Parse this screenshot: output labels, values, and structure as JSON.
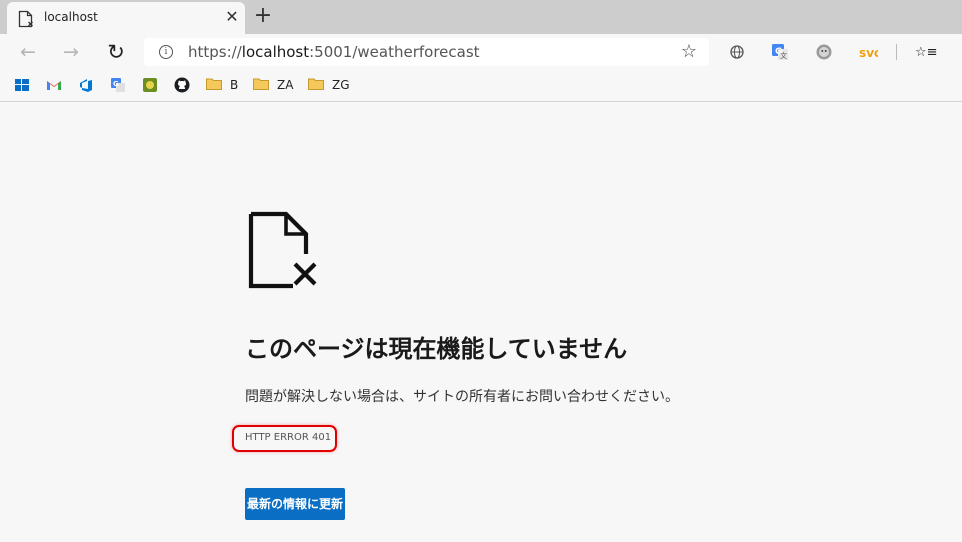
{
  "browser": {
    "tab": {
      "title": "localhost",
      "close_glyph": "✕",
      "favicon": "error-page-icon"
    },
    "new_tab_glyph": "+",
    "nav": {
      "back_glyph": "←",
      "forward_glyph": "→",
      "refresh_glyph": "↻"
    },
    "address": {
      "scheme": "https://",
      "host": "localhost",
      "rest": ":5001/weatherforecast",
      "info_glyph": "i",
      "favorite_glyph": "☆"
    },
    "extensions": [
      "globe-icon",
      "google-translate-icon",
      "cat-extension-icon",
      "svg-extension-icon"
    ],
    "favorites_glyph": "☆≡"
  },
  "bookmarks": [
    {
      "icon": "windows-icon",
      "label": ""
    },
    {
      "icon": "gmail-icon",
      "label": ""
    },
    {
      "icon": "azure-devops-icon",
      "label": ""
    },
    {
      "icon": "google-translate-icon",
      "label": ""
    },
    {
      "icon": "extension-icon",
      "label": ""
    },
    {
      "icon": "github-icon",
      "label": ""
    },
    {
      "icon": "folder-icon",
      "label": "B"
    },
    {
      "icon": "folder-icon",
      "label": "ZA"
    },
    {
      "icon": "folder-icon",
      "label": "ZG"
    }
  ],
  "page": {
    "heading": "このページは現在機能していません",
    "description": "問題が解決しない場合は、サイトの所有者にお問い合わせください。",
    "error_code": "HTTP ERROR 401",
    "reload_button": "最新の情報に更新"
  },
  "colors": {
    "accent": "#0a6fc4",
    "highlight_box": "#e00000",
    "page_background": "#f7f7f7",
    "tab_strip": "#cdcdcd"
  }
}
